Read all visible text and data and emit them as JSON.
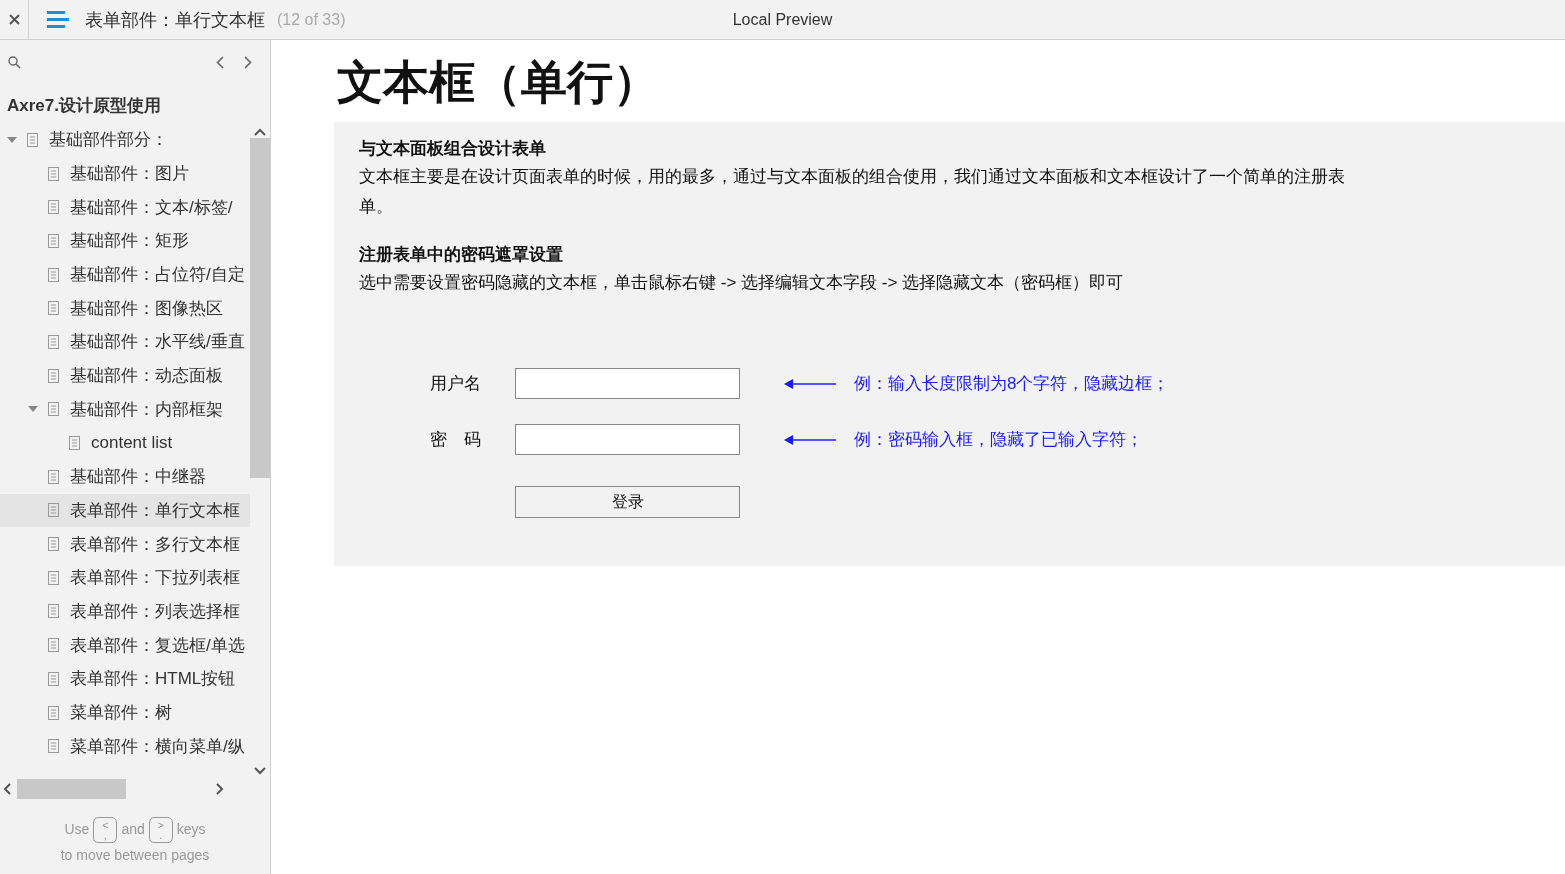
{
  "header": {
    "title": "表单部件：单行文本框",
    "page_count": "(12 of 33)",
    "preview_title": "Local Preview"
  },
  "sidebar": {
    "project": "Axre7.设计原型使用",
    "tree": [
      {
        "label": "基础部件部分：",
        "selected": false,
        "expanded": true,
        "children": [
          {
            "label": "基础部件：图片",
            "selected": false
          },
          {
            "label": "基础部件：文本/标签/",
            "selected": false
          },
          {
            "label": "基础部件：矩形",
            "selected": false
          },
          {
            "label": "基础部件：占位符/自定",
            "selected": false
          },
          {
            "label": "基础部件：图像热区",
            "selected": false
          },
          {
            "label": "基础部件：水平线/垂直",
            "selected": false
          },
          {
            "label": "基础部件：动态面板",
            "selected": false
          },
          {
            "label": "基础部件：内部框架",
            "selected": false,
            "expanded": true,
            "children": [
              {
                "label": "content list",
                "selected": false
              }
            ]
          },
          {
            "label": "基础部件：中继器",
            "selected": false
          },
          {
            "label": "表单部件：单行文本框",
            "selected": true
          },
          {
            "label": "表单部件：多行文本框",
            "selected": false
          },
          {
            "label": "表单部件：下拉列表框",
            "selected": false
          },
          {
            "label": "表单部件：列表选择框",
            "selected": false
          },
          {
            "label": "表单部件：复选框/单选",
            "selected": false
          },
          {
            "label": "表单部件：HTML按钮",
            "selected": false
          },
          {
            "label": "菜单部件：树",
            "selected": false
          },
          {
            "label": "菜单部件：横向菜单/纵",
            "selected": false
          }
        ]
      }
    ],
    "hint": {
      "use": "Use",
      "key_prev": {
        "top": "<",
        "bottom": ","
      },
      "and": "and",
      "key_next": {
        "top": ">",
        "bottom": "."
      },
      "keys": "keys",
      "line2": "to move between pages"
    }
  },
  "page": {
    "title": "文本框（单行）",
    "sections": [
      {
        "heading": "与文本面板组合设计表单",
        "body": "文本框主要是在设计页面表单的时候，用的最多，通过与文本面板的组合使用，我们通过文本面板和文本框设计了一个简单的注册表单。"
      },
      {
        "heading": "注册表单中的密码遮罩设置",
        "body": " 选中需要设置密码隐藏的文本框，单击鼠标右键 -> 选择编辑文本字段 -> 选择隐藏文本（密码框）即可"
      }
    ],
    "form": {
      "fields": [
        {
          "label": "用户名",
          "note": "例：输入长度限制为8个字符，隐藏边框；"
        },
        {
          "label": "密　码",
          "note": "例：密码输入框，隐藏了已输入字符；"
        }
      ],
      "button": "登录"
    }
  }
}
